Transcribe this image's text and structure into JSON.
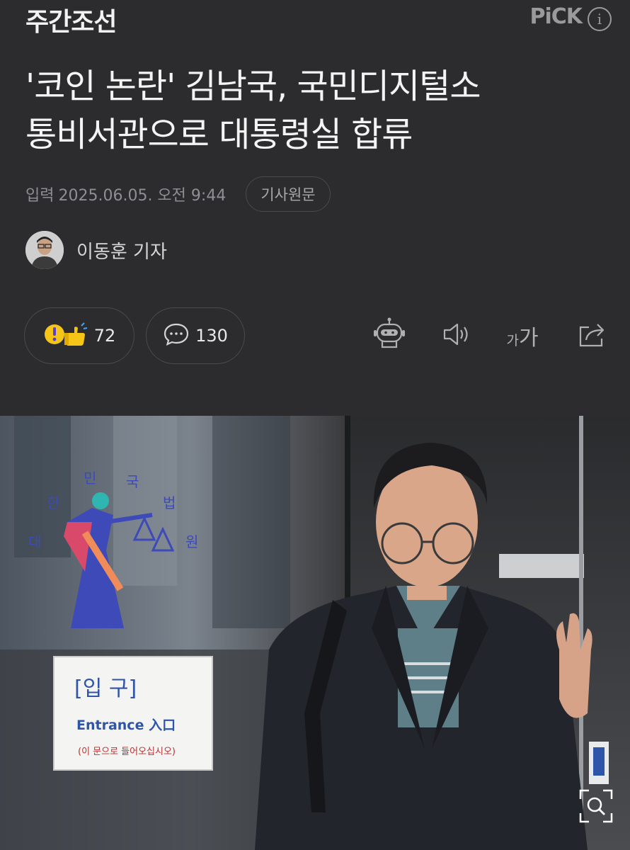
{
  "header": {
    "publisher": "주간조선",
    "pick_label": "PiCK",
    "info_icon": "i"
  },
  "article": {
    "headline_line1": "'코인 논란' 김남국, 국민디지털소",
    "headline_line2": "통비서관으로 대통령실 합류",
    "date_label": "입력",
    "date_value": "2025.06.05. 오전 9:44",
    "original_button": "기사원문",
    "reporter": "이동훈 기자"
  },
  "actions": {
    "reaction_count": "72",
    "comment_count": "130",
    "font_label_small": "가",
    "font_label_large": "가"
  },
  "photo_sign": {
    "line1": "[입     구]",
    "line2": "Entrance 入口",
    "line3": "(이 문으로 들어오십시오)"
  },
  "icons": [
    "info-icon",
    "emoji-reaction-icon",
    "comment-icon",
    "ai-bot-icon",
    "audio-icon",
    "font-size-icon",
    "share-icon",
    "zoom-icon"
  ],
  "colors": {
    "background": "#2c2c2e",
    "text": "#f4f4f4",
    "muted": "#8e8e93",
    "border": "#4a4a4d"
  }
}
